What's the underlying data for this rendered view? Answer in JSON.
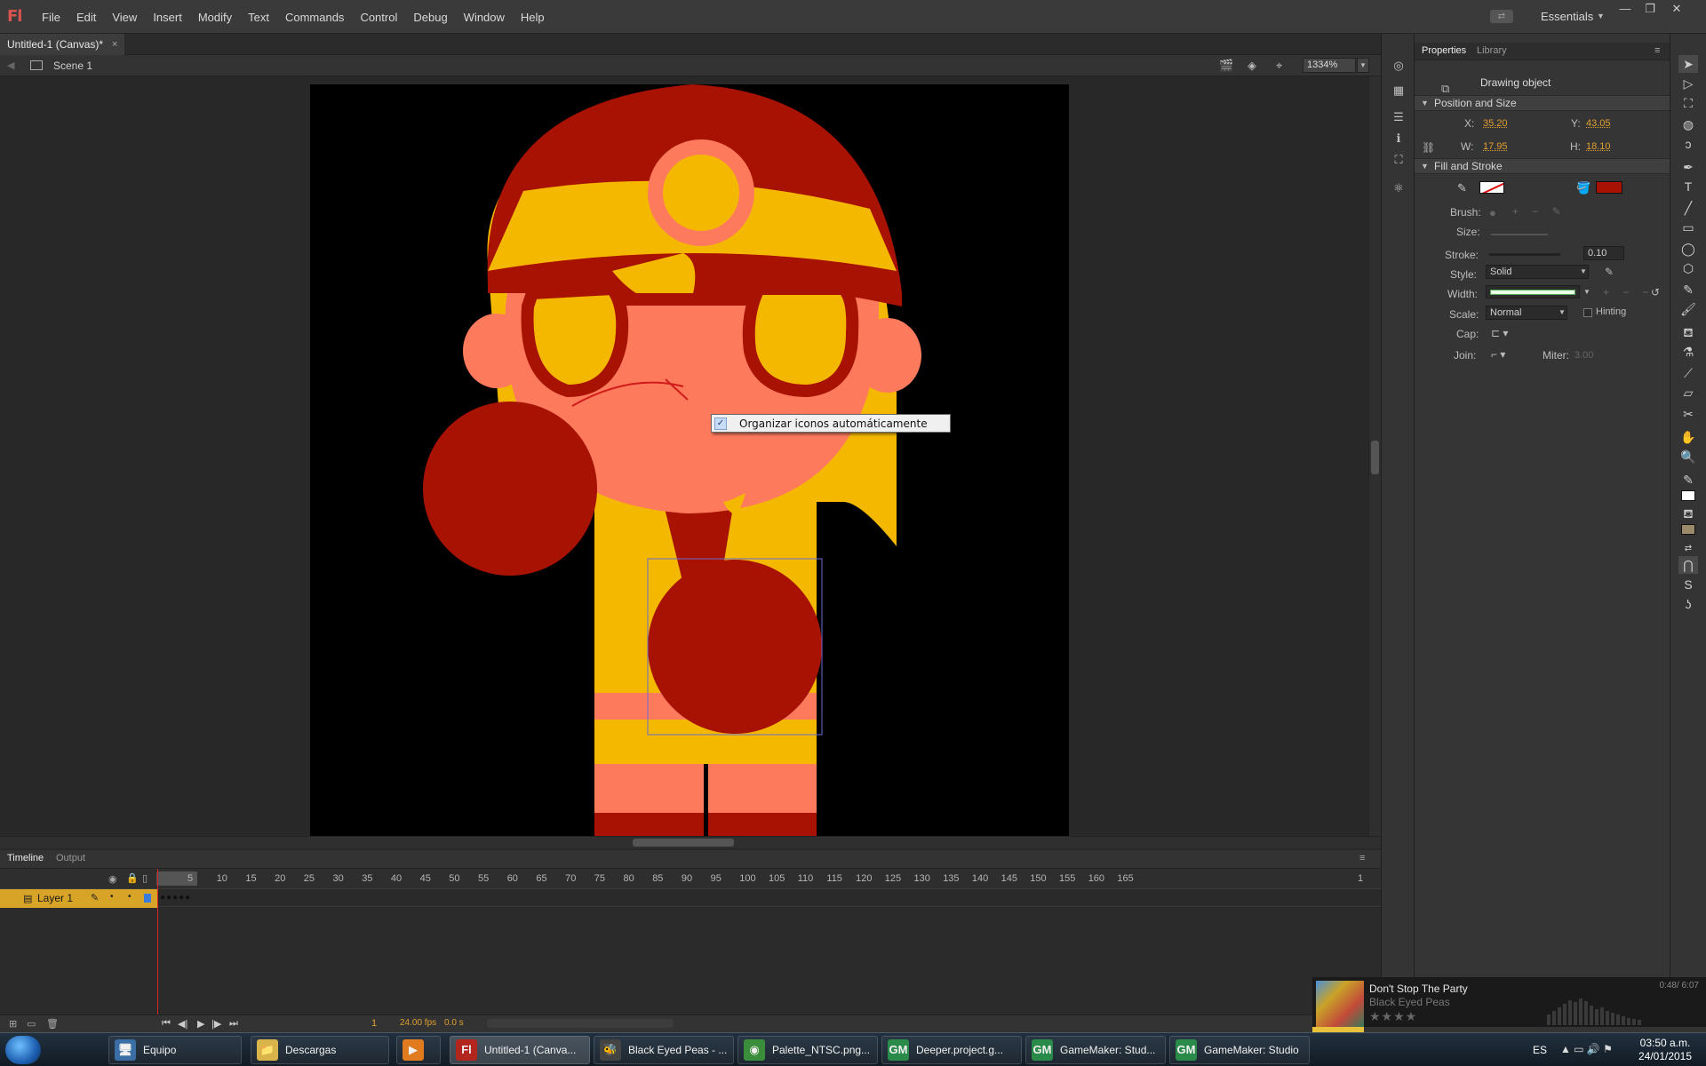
{
  "app": {
    "logo": "Fl",
    "menu": [
      "File",
      "Edit",
      "View",
      "Insert",
      "Modify",
      "Text",
      "Commands",
      "Control",
      "Debug",
      "Window",
      "Help"
    ],
    "workspace": "Essentials"
  },
  "document": {
    "tab_title": "Untitled-1 (Canvas)*",
    "close_glyph": "×",
    "scene": "Scene 1",
    "zoom": "1334%"
  },
  "context_menu": {
    "item_label": "Organizar iconos automáticamente",
    "checked": true
  },
  "timeline": {
    "tabs": [
      "Timeline",
      "Output"
    ],
    "layer_name": "Layer 1",
    "frame_ticks": [
      "5",
      "10",
      "15",
      "20",
      "25",
      "30",
      "35",
      "40",
      "45",
      "50",
      "55",
      "60",
      "65",
      "70",
      "75",
      "80",
      "85",
      "90",
      "95",
      "100",
      "105",
      "110",
      "115",
      "120",
      "125",
      "130",
      "135",
      "140",
      "145",
      "150",
      "155",
      "160",
      "165",
      "1"
    ],
    "current_frame": "1",
    "fps": "24.00 fps",
    "elapsed": "0.0 s"
  },
  "properties": {
    "tabs": [
      "Properties",
      "Library"
    ],
    "object_type": "Drawing object",
    "position_size": {
      "header": "Position and Size",
      "x_label": "X:",
      "x": "35.20",
      "y_label": "Y:",
      "y": "43.05",
      "w_label": "W:",
      "w": "17.95",
      "h_label": "H:",
      "h": "18.10"
    },
    "fill_stroke": {
      "header": "Fill and Stroke",
      "fill_color": "#a81203",
      "brush_label": "Brush:",
      "size_label": "Size:",
      "stroke_label": "Stroke:",
      "stroke_value": "0.10",
      "style_label": "Style:",
      "style_value": "Solid",
      "width_label": "Width:",
      "scale_label": "Scale:",
      "scale_value": "Normal",
      "hinting_label": "Hinting",
      "cap_label": "Cap:",
      "join_label": "Join:",
      "miter_label": "Miter:",
      "miter_value": "3.00"
    }
  },
  "music_player": {
    "title": "Don't Stop The Party",
    "artist": "Black Eyed Peas",
    "time": "0:48/ 6:07",
    "progress": 0.13,
    "stars": "★★★★"
  },
  "taskbar": {
    "items": [
      {
        "label": "Equipo",
        "icon": "computer-icon",
        "color": "#3a6ea5"
      },
      {
        "label": "Descargas",
        "icon": "folder-icon",
        "color": "#d9b44a"
      },
      {
        "label": "",
        "icon": "media-player-icon",
        "color": "#e07b20"
      },
      {
        "label": "Untitled-1 (Canva...",
        "icon": "flash-icon",
        "color": "#b3261e"
      },
      {
        "label": "Black Eyed Peas - ...",
        "icon": "bee-icon",
        "color": "#444"
      },
      {
        "label": "Palette_NTSC.png...",
        "icon": "chrome-icon",
        "color": "#3a8d3a"
      },
      {
        "label": "Deeper.project.g...",
        "icon": "gamemaker-icon",
        "color": "#2a8a4a"
      },
      {
        "label": "GameMaker: Stud...",
        "icon": "gamemaker-icon",
        "color": "#2a8a4a"
      },
      {
        "label": "GameMaker: Studio",
        "icon": "gamemaker-icon",
        "color": "#2a8a4a"
      }
    ],
    "language": "ES",
    "time": "03:50 a.m.",
    "date": "24/01/2015"
  },
  "colors": {
    "dark_red": "#a81203",
    "yellow": "#f5b800",
    "salmon": "#fd7b5c",
    "stage_bg": "#000000",
    "layer_highlight": "#d8a428"
  }
}
